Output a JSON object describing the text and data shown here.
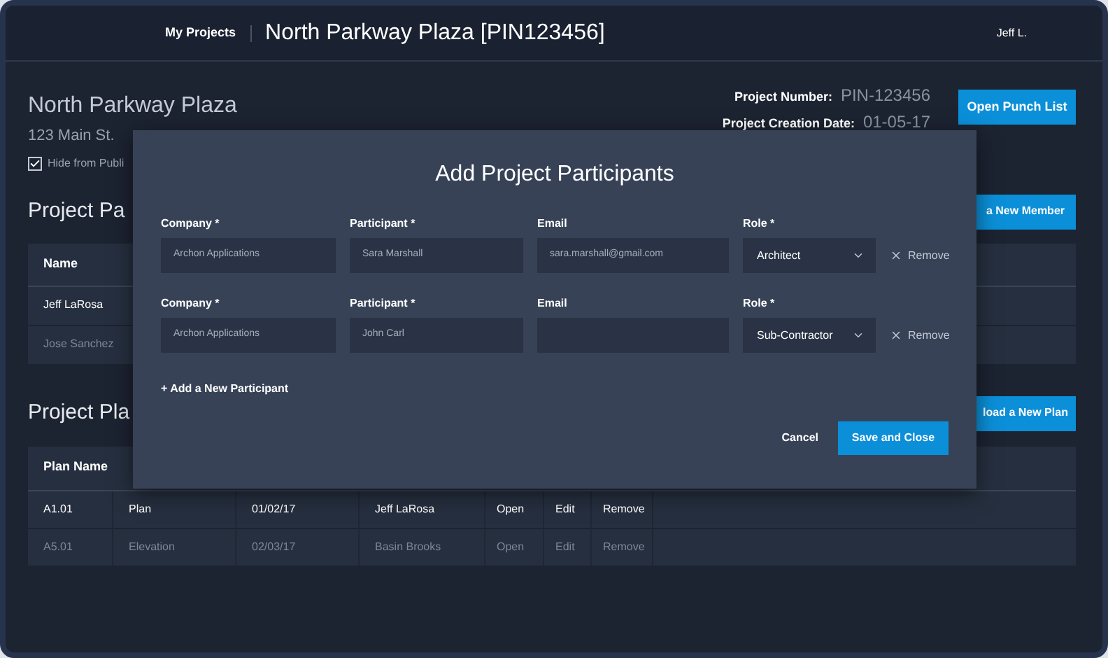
{
  "header": {
    "nav_link": "My Projects",
    "title": "North Parkway Plaza [PIN123456]",
    "user": "Jeff L."
  },
  "project": {
    "name": "North Parkway Plaza",
    "address": "123 Main St.",
    "hide_label": "Hide from Publi",
    "hide_checked": true,
    "fields": [
      {
        "label": "Project Number:",
        "value": "PIN-123456"
      },
      {
        "label": "Project Creation Date:",
        "value": "01-05-17"
      }
    ],
    "punch_button": "Open Punch List"
  },
  "participants_section": {
    "heading": "Project Pa",
    "add_button": "a New Member",
    "columns": [
      "Name"
    ],
    "rows": [
      {
        "name": "Jeff LaRosa",
        "dimmed": false
      },
      {
        "name": "Jose Sanchez",
        "dimmed": true
      }
    ]
  },
  "plans_section": {
    "heading": "Project Pla",
    "upload_button": "load a New Plan",
    "columns": [
      "Plan Name"
    ],
    "rows": [
      {
        "cells": [
          "A1.01",
          "Plan",
          "01/02/17",
          "Jeff LaRosa"
        ],
        "actions": [
          "Open",
          "Edit",
          "Remove"
        ],
        "dimmed": false
      },
      {
        "cells": [
          "A5.01",
          "Elevation",
          "02/03/17",
          "Basin Brooks"
        ],
        "actions": [
          "Open",
          "Edit",
          "Remove"
        ],
        "dimmed": true
      }
    ]
  },
  "modal": {
    "title": "Add Project Participants",
    "participants": [
      {
        "company_label": "Company *",
        "company": "Archon Applications",
        "participant_label": "Participant *",
        "participant": "Sara Marshall",
        "email_label": "Email",
        "email": "sara.marshall@gmail.com",
        "role_label": "Role *",
        "role": "Architect",
        "remove": "Remove"
      },
      {
        "company_label": "Company *",
        "company": "Archon Applications",
        "participant_label": "Participant *",
        "participant": "John Carl",
        "email_label": "Email",
        "role_label": "Role *",
        "role": "Sub-Contractor",
        "remove": "Remove"
      }
    ],
    "add_link": "+ Add a New Participant",
    "cancel": "Cancel",
    "save": "Save and Close"
  }
}
